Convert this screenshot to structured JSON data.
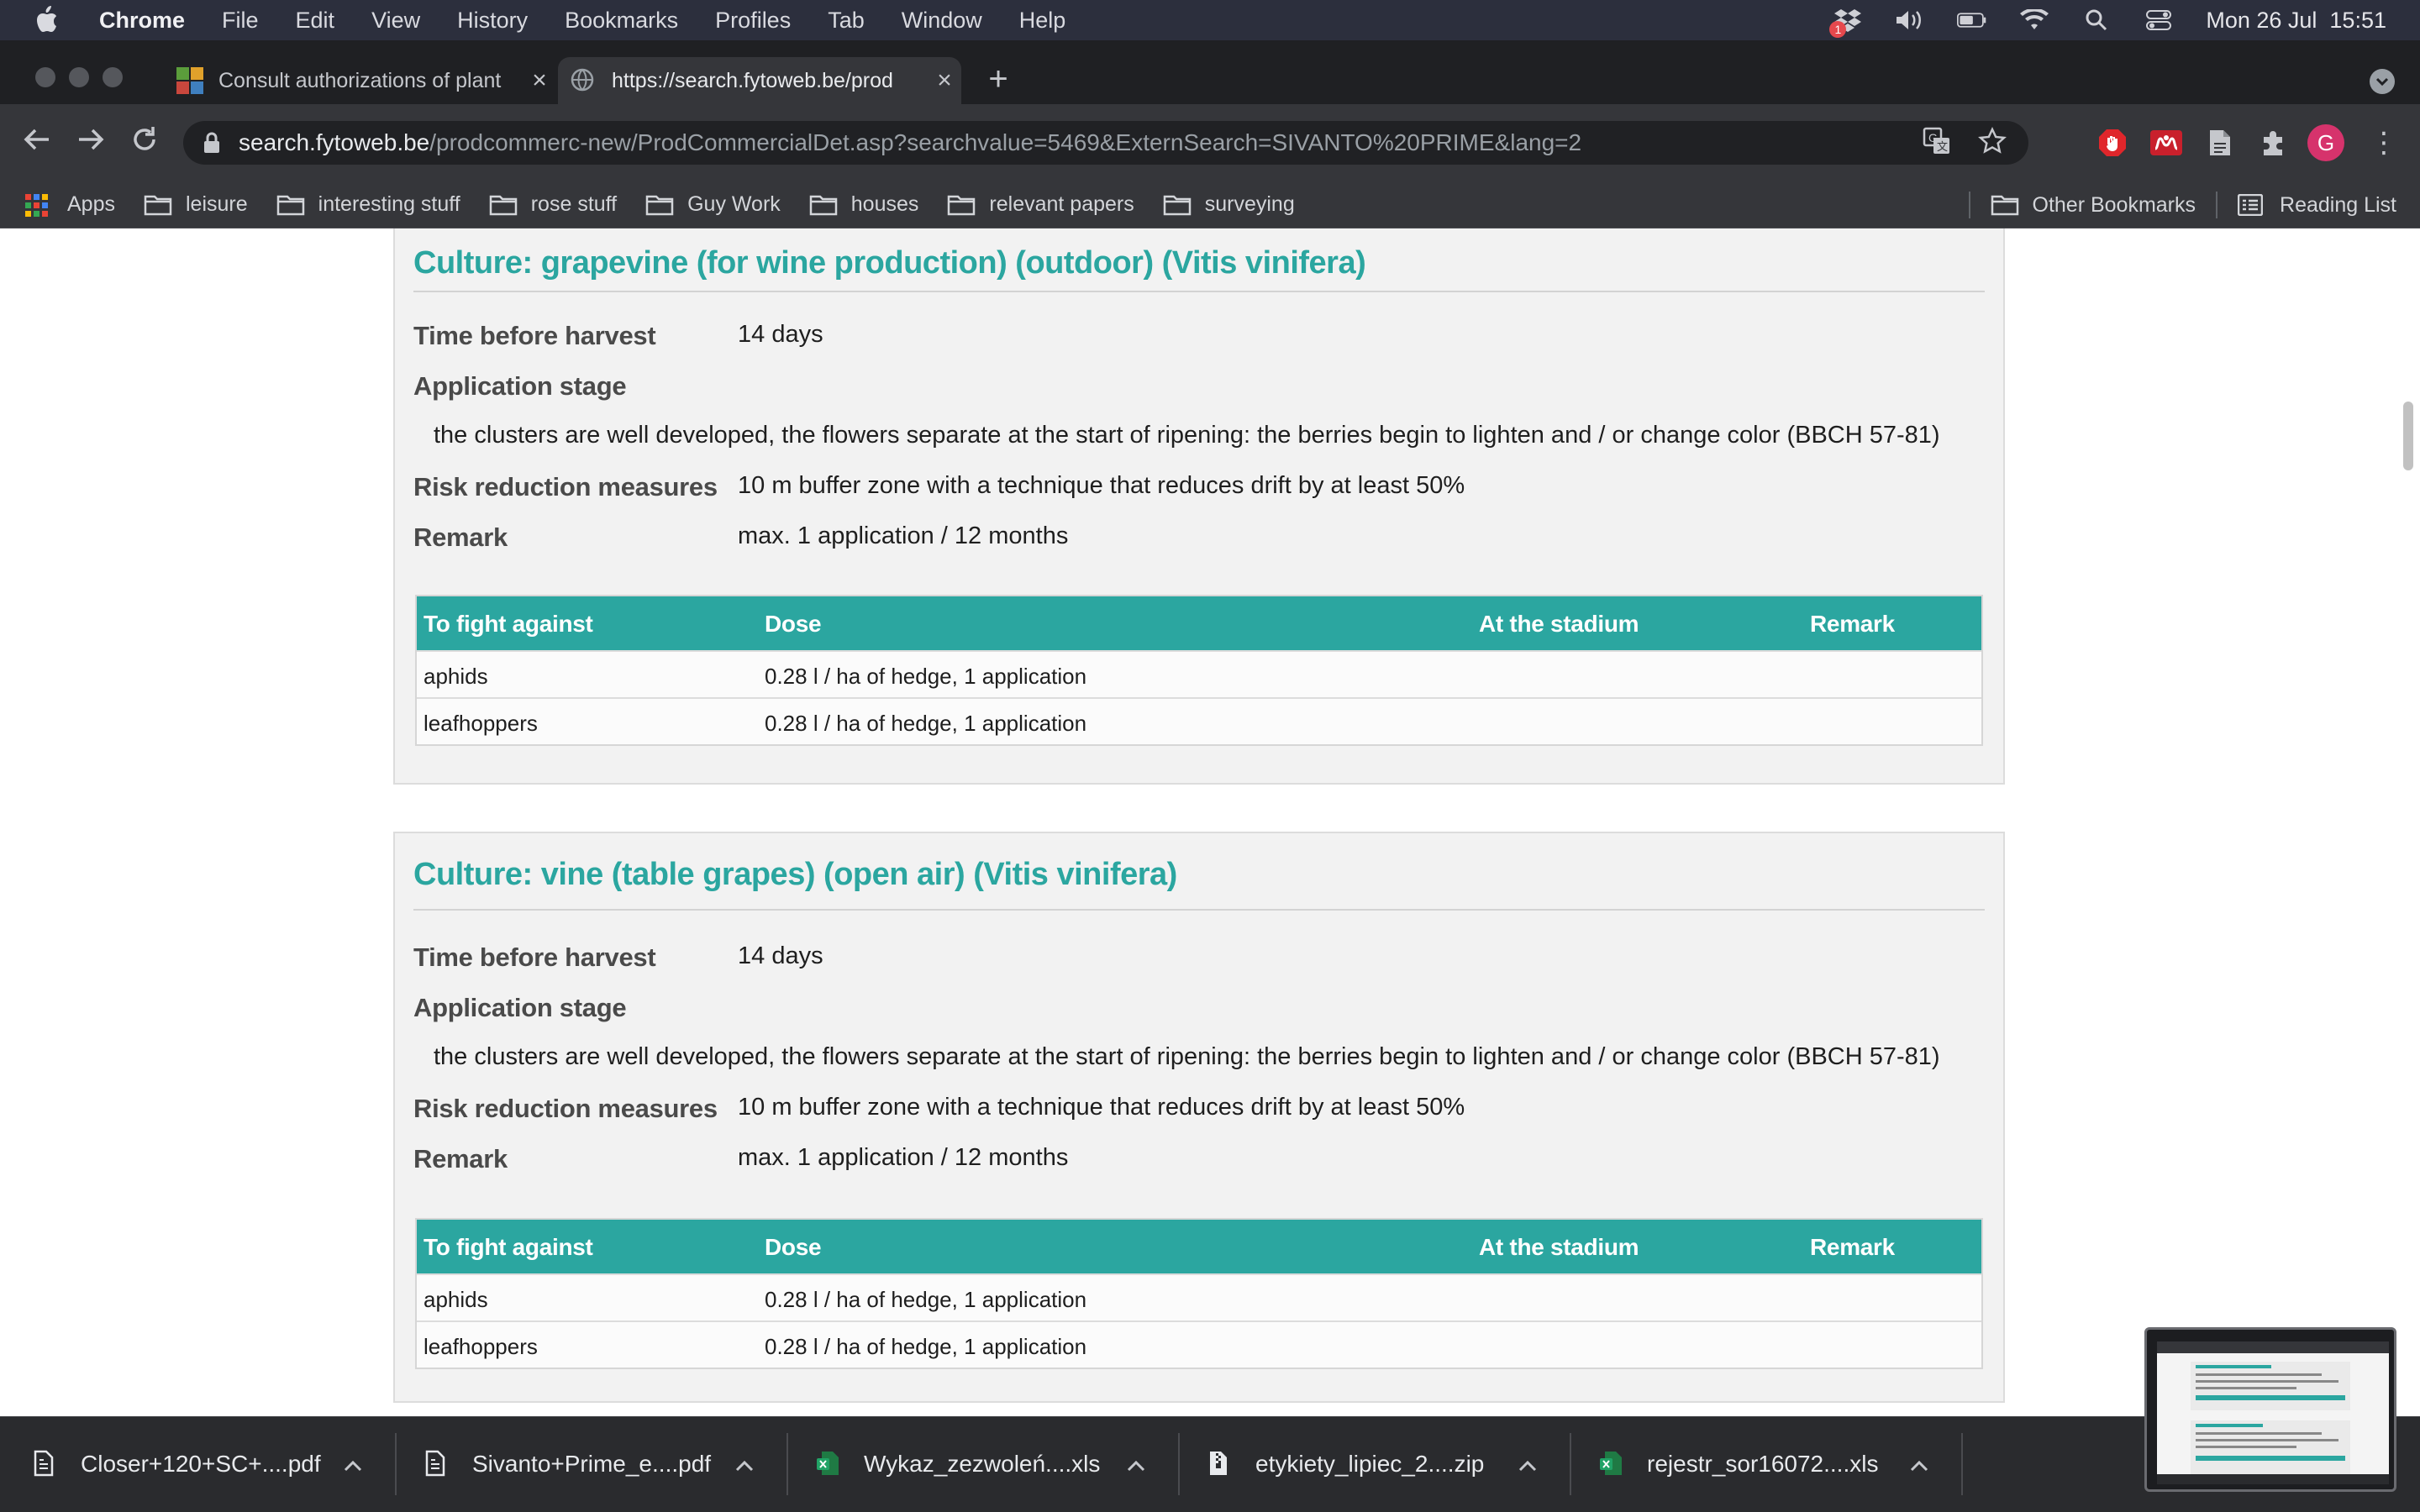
{
  "menubar": {
    "app_name": "Chrome",
    "menus": [
      "File",
      "Edit",
      "View",
      "History",
      "Bookmarks",
      "Profiles",
      "Tab",
      "Window",
      "Help"
    ],
    "datetime": "Mon 26 Jul  15:51",
    "notification_badge": "1"
  },
  "tabs": [
    {
      "title": "Consult authorizations of plant",
      "active": false
    },
    {
      "title": "https://search.fytoweb.be/prod",
      "active": true
    }
  ],
  "omnibox": {
    "host": "search.fytoweb.be",
    "path": "/prodcommerc-new/ProdCommercialDet.asp?searchvalue=5469&ExternSearch=SIVANTO%20PRIME&lang=2"
  },
  "profile_initial": "G",
  "bookmarks": {
    "apps_label": "Apps",
    "folders": [
      "leisure",
      "interesting stuff",
      "rose stuff",
      "Guy Work",
      "houses",
      "relevant papers",
      "surveying"
    ],
    "other": "Other Bookmarks",
    "reading_list": "Reading List"
  },
  "labels": {
    "time_before_harvest": "Time before harvest",
    "application_stage": "Application stage",
    "risk_reduction": "Risk reduction measures",
    "remark": "Remark"
  },
  "table_headers": [
    "To fight against",
    "Dose",
    "At the stadium",
    "Remark"
  ],
  "cultures": [
    {
      "title": "Culture: grapevine (for wine production) (outdoor) (Vitis vinifera)",
      "time_before_harvest": "14 days",
      "application_stage": "the clusters are well developed, the flowers separate at the start of ripening: the berries begin to lighten and / or change color (BBCH 57-81)",
      "risk_reduction": "10 m buffer zone with a technique that reduces drift by at least 50%",
      "remark": "max. 1 application / 12 months",
      "rows": [
        {
          "pest": "aphids",
          "dose": "0.28 l / ha of hedge, 1 application",
          "stadium": "",
          "remark": ""
        },
        {
          "pest": "leafhoppers",
          "dose": "0.28 l / ha of hedge, 1 application",
          "stadium": "",
          "remark": ""
        }
      ]
    },
    {
      "title": "Culture: vine (table grapes) (open air) (Vitis vinifera)",
      "time_before_harvest": "14 days",
      "application_stage": "the clusters are well developed, the flowers separate at the start of ripening: the berries begin to lighten and / or change color (BBCH 57-81)",
      "risk_reduction": "10 m buffer zone with a technique that reduces drift by at least 50%",
      "remark": "max. 1 application / 12 months",
      "rows": [
        {
          "pest": "aphids",
          "dose": "0.28 l / ha of hedge, 1 application",
          "stadium": "",
          "remark": ""
        },
        {
          "pest": "leafhoppers",
          "dose": "0.28 l / ha of hedge, 1 application",
          "stadium": "",
          "remark": ""
        }
      ]
    }
  ],
  "downloads": [
    {
      "name": "Closer+120+SC+....pdf",
      "icon": "pdf-file-icon"
    },
    {
      "name": "Sivanto+Prime_e....pdf",
      "icon": "pdf-file-icon"
    },
    {
      "name": "Wykaz_zezwoleń....xls",
      "icon": "excel-file-icon"
    },
    {
      "name": "etykiety_lipiec_2....zip",
      "icon": "zip-file-icon"
    },
    {
      "name": "rejestr_sor16072....xls",
      "icon": "excel-file-icon"
    }
  ],
  "colors": {
    "accent_teal": "#2ba6a0",
    "panel_bg": "#f2f2f2",
    "chrome_toolbar": "#35363a",
    "menubar": "#2c2f3d"
  }
}
